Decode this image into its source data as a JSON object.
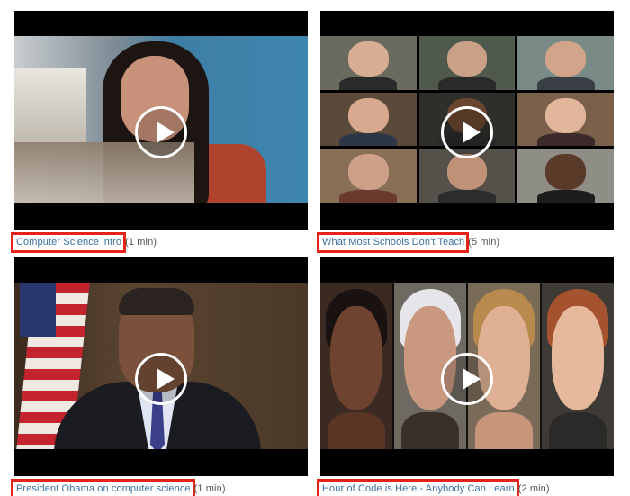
{
  "videos": [
    {
      "title": "Computer Science intro",
      "duration": "(1 min)"
    },
    {
      "title": "What Most Schools Don't Teach",
      "duration": "(5 min)"
    },
    {
      "title": "President Obama on computer science",
      "duration": "(1 min)"
    },
    {
      "title": "Hour of Code is Here - Anybody Can Learn",
      "duration": "(2 min)"
    }
  ],
  "icons": {
    "play": "play-icon"
  },
  "colors": {
    "highlight_border": "#e5231a",
    "link": "#3c6f9e",
    "duration_text": "#555555",
    "video_bg": "#000000"
  }
}
